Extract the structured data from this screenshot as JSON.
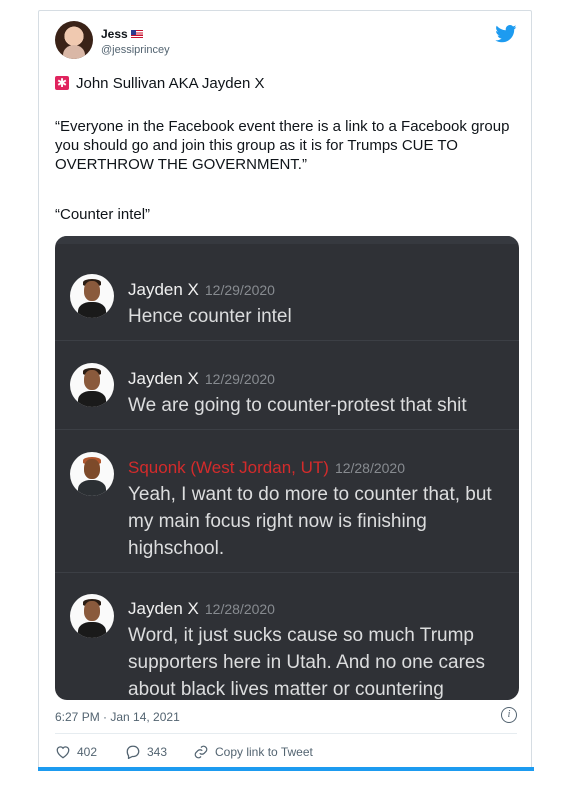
{
  "author": {
    "name": "Jess",
    "handle": "@jessiprincey"
  },
  "tweet": {
    "line1": "John Sullivan AKA Jayden X",
    "quote": "“Everyone in the Facebook event there is a link to a Facebook group you should go and join this group as it is for Trumps CUE TO OVERTHROW THE GOVERNMENT.”",
    "line3": "“Counter intel”",
    "timestamp": "6:27 PM · Jan 14, 2021"
  },
  "embed": {
    "messages": [
      {
        "author": "Jayden X",
        "date": "12/29/2020",
        "text": "Hence counter intel",
        "author_color": "#ffffff"
      },
      {
        "author": "Jayden X",
        "date": "12/29/2020",
        "text": "We are going to counter-protest that shit",
        "author_color": "#ffffff"
      },
      {
        "author": "Squonk (West Jordan, UT)",
        "date": "12/28/2020",
        "text": "Yeah, I want to do more to counter that, but my main focus right now is finishing highschool.",
        "author_color": "#e02b2b"
      },
      {
        "author": "Jayden X",
        "date": "12/28/2020",
        "text": "Word, it just sucks cause so much Trump supporters here in Utah. And no one cares about black lives matter or countering",
        "author_color": "#ffffff"
      }
    ]
  },
  "actions": {
    "likes": "402",
    "replies": "343",
    "share_label": "Copy link to Tweet"
  },
  "colors": {
    "accent": "#1d9bf0",
    "embed_bg": "#2f3136",
    "red_author": "#e02b2b"
  },
  "icons": [
    "twitter-bird-icon",
    "siren-emoji-icon",
    "us-flag-icon",
    "info-icon",
    "heart-icon",
    "reply-icon",
    "link-icon"
  ]
}
